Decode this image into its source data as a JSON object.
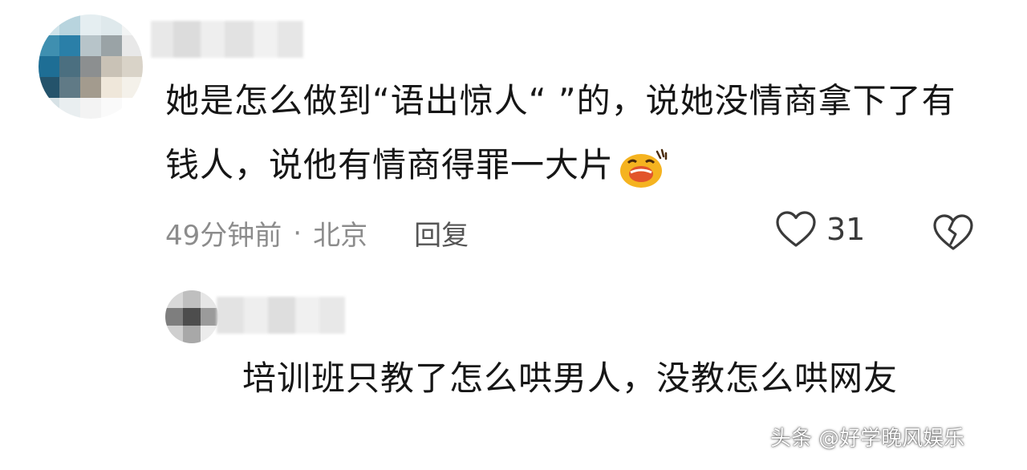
{
  "comments": [
    {
      "text": "她是怎么做到“语出惊人“ ”的，说她没情商拿下了有钱人，说他有情商得罪一大片",
      "time": "49分钟前",
      "separator": "·",
      "location": "北京",
      "reply_label": "回复",
      "like_count": "31",
      "emoji_icon": "crying-laughing-emoji"
    },
    {
      "text": "培训班只教了怎么哄男人，没教怎么哄网友"
    }
  ],
  "watermark": "头条 @好学晚风娱乐",
  "colors": {
    "text": "#161616",
    "meta": "#8c8c8c",
    "background": "#ffffff",
    "emoji": "#f5b320"
  }
}
